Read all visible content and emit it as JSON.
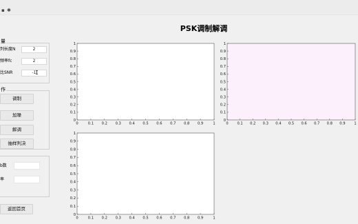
{
  "window": {
    "title_icons": [
      "window-icon-1",
      "window-icon-2"
    ]
  },
  "app": {
    "title": "PSK调制解调"
  },
  "params_panel": {
    "title": "量",
    "rows": [
      {
        "label": "列长度N",
        "value": "2"
      },
      {
        "label": "频率fc",
        "value": "2"
      },
      {
        "label": "比SNR",
        "value": "-1"
      }
    ]
  },
  "ops_panel": {
    "title": "作",
    "buttons": [
      "调制",
      "加噪",
      "解调",
      "抽样判决"
    ]
  },
  "results_panel": {
    "rows": [
      {
        "label": "b数",
        "value": ""
      },
      {
        "label": "率",
        "value": ""
      }
    ]
  },
  "back_button": {
    "label": "返回首页"
  },
  "axes_ticks": {
    "y": [
      "0",
      "0.1",
      "0.2",
      "0.3",
      "0.4",
      "0.5",
      "0.6",
      "0.7",
      "0.8",
      "0.9",
      "1"
    ],
    "x": [
      "0",
      "0.1",
      "0.2",
      "0.3",
      "0.4",
      "0.5",
      "0.6",
      "0.7",
      "0.8",
      "0.9",
      "1"
    ]
  },
  "colors": {
    "plot_bg_white": "#ffffff",
    "plot_bg_pink": "#fbf0fb"
  },
  "chart_data": [
    {
      "type": "line",
      "series": [],
      "xlim": [
        0,
        1
      ],
      "ylim": [
        0,
        1
      ],
      "xticks": [
        "0",
        "0.1",
        "0.2",
        "0.3",
        "0.4",
        "0.5",
        "0.6",
        "0.7",
        "0.8",
        "0.9",
        "1"
      ],
      "yticks": [
        "0",
        "0.1",
        "0.2",
        "0.3",
        "0.4",
        "0.5",
        "0.6",
        "0.7",
        "0.8",
        "0.9",
        "1"
      ]
    },
    {
      "type": "line",
      "series": [],
      "xlim": [
        0,
        1
      ],
      "ylim": [
        0,
        1
      ],
      "xticks": [
        "0",
        "0.1",
        "0.2",
        "0.3",
        "0.4",
        "0.5",
        "0.6",
        "0.7",
        "0.8",
        "0.9",
        "1"
      ],
      "yticks": [
        "0",
        "0.1",
        "0.2",
        "0.3",
        "0.4",
        "0.5",
        "0.6",
        "0.7",
        "0.8",
        "0.9",
        "1"
      ]
    },
    {
      "type": "line",
      "series": [],
      "xlim": [
        0,
        1
      ],
      "ylim": [
        0,
        1
      ],
      "xticks": [
        "0",
        "0.1",
        "0.2",
        "0.3",
        "0.4",
        "0.5",
        "0.6",
        "0.7",
        "0.8",
        "0.9",
        "1"
      ],
      "yticks": [
        "0",
        "0.1",
        "0.2",
        "0.3",
        "0.4",
        "0.5",
        "0.6",
        "0.7",
        "0.8",
        "0.9",
        "1"
      ]
    }
  ]
}
